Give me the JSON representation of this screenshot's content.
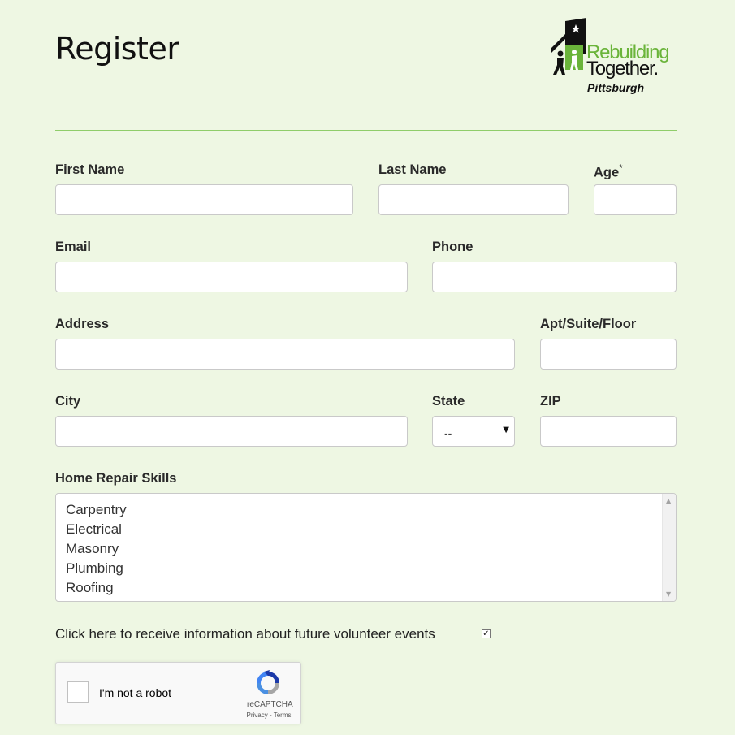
{
  "page": {
    "title": "Register"
  },
  "logo": {
    "line1": "Rebuilding",
    "line2": "Together.",
    "line3": "Pittsburgh"
  },
  "form": {
    "first_name": {
      "label": "First Name",
      "value": ""
    },
    "last_name": {
      "label": "Last Name",
      "value": ""
    },
    "age": {
      "label": "Age",
      "required_mark": "*",
      "value": ""
    },
    "email": {
      "label": "Email",
      "value": ""
    },
    "phone": {
      "label": "Phone",
      "value": ""
    },
    "address": {
      "label": "Address",
      "value": ""
    },
    "apt": {
      "label": "Apt/Suite/Floor",
      "value": ""
    },
    "city": {
      "label": "City",
      "value": ""
    },
    "state": {
      "label": "State",
      "selected": "--"
    },
    "zip": {
      "label": "ZIP",
      "value": ""
    },
    "skills": {
      "label": "Home Repair Skills",
      "options": [
        "Carpentry",
        "Electrical",
        "Masonry",
        "Plumbing",
        "Roofing"
      ]
    },
    "opt_in": {
      "label": "Click here to receive information about future volunteer events",
      "checked": true
    }
  },
  "captcha": {
    "text": "I'm not a robot",
    "brand": "reCAPTCHA",
    "links": "Privacy - Terms"
  },
  "colors": {
    "background": "#eef7e3",
    "accent": "#6ab43a",
    "divider": "#8fcd6a"
  }
}
